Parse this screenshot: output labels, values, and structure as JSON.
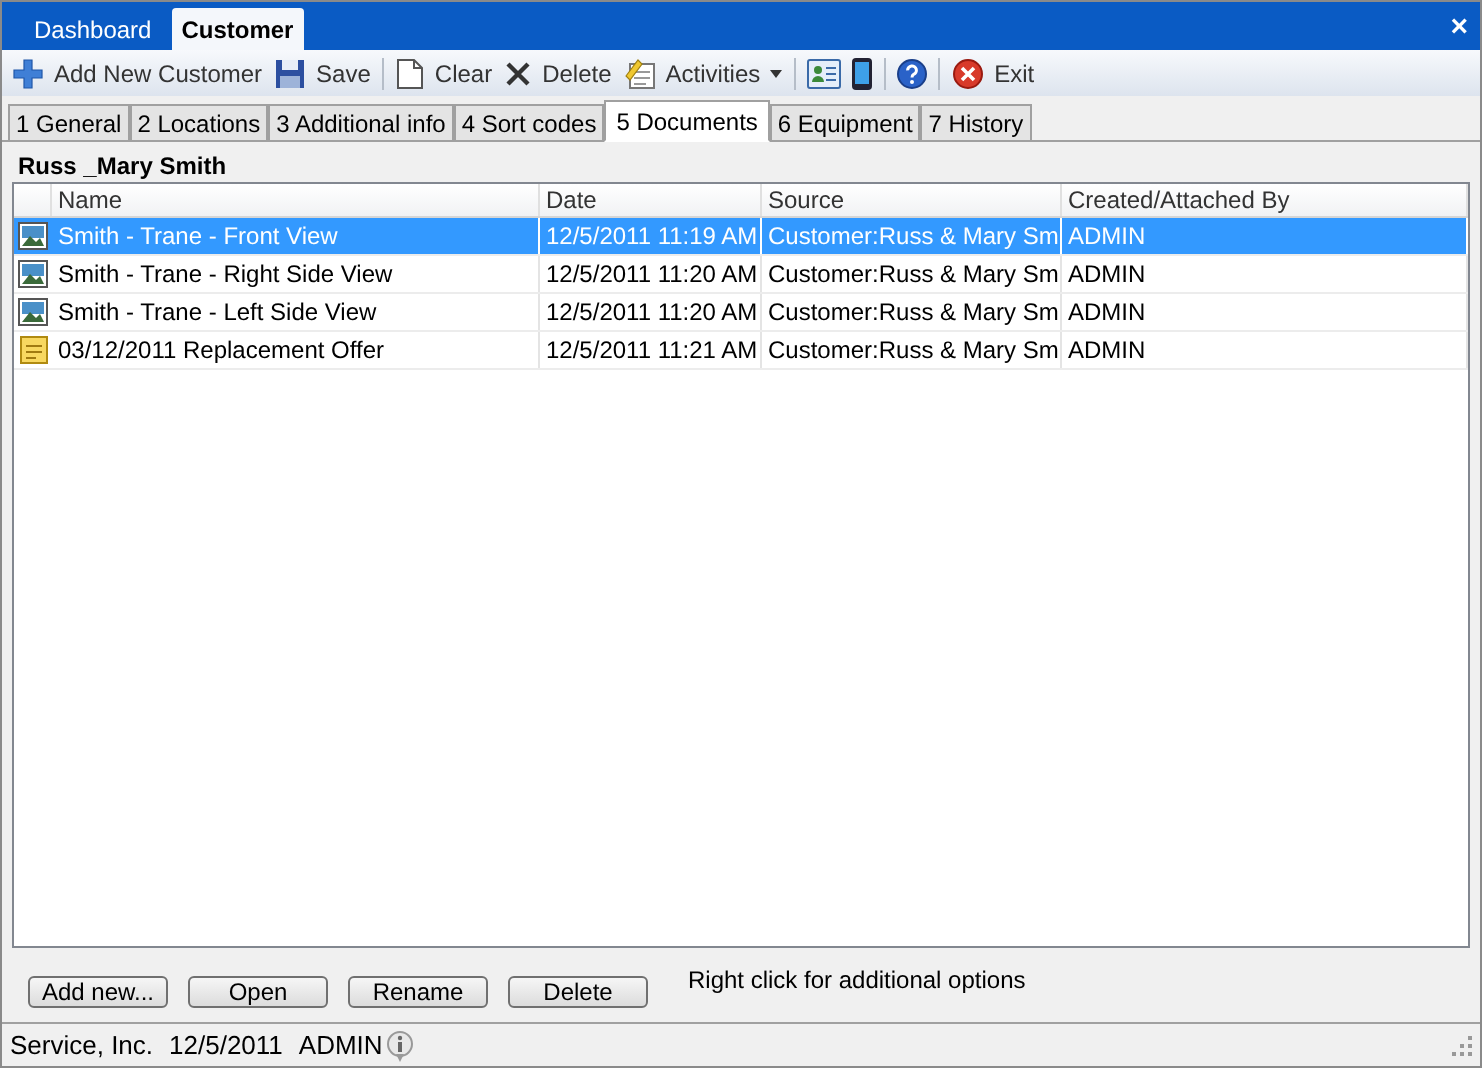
{
  "top_tabs": [
    {
      "label": "Dashboard",
      "selected": false
    },
    {
      "label": "Customer",
      "selected": true
    }
  ],
  "close_glyph": "×",
  "toolbar": [
    {
      "kind": "plus",
      "label": "Add New Customer"
    },
    {
      "kind": "save",
      "label": "Save"
    },
    {
      "kind": "separator"
    },
    {
      "kind": "page",
      "label": "Clear"
    },
    {
      "kind": "delete",
      "label": "Delete"
    },
    {
      "kind": "notepad",
      "label": "Activities",
      "dropdown": true
    },
    {
      "kind": "separator"
    },
    {
      "kind": "card"
    },
    {
      "kind": "phone"
    },
    {
      "kind": "separator"
    },
    {
      "kind": "help"
    },
    {
      "kind": "separator"
    },
    {
      "kind": "exit",
      "label": "Exit"
    }
  ],
  "tabs": [
    {
      "label": "1 General",
      "selected": false
    },
    {
      "label": "2 Locations",
      "selected": false
    },
    {
      "label": "3 Additional info",
      "selected": false
    },
    {
      "label": "4 Sort codes",
      "selected": false
    },
    {
      "label": "5 Documents",
      "selected": true
    },
    {
      "label": "6 Equipment",
      "selected": false
    },
    {
      "label": "7 History",
      "selected": false
    }
  ],
  "customer_name": "Russ _Mary Smith",
  "table": {
    "columns": [
      "Name",
      "Date",
      "Source",
      "Created/Attached By"
    ],
    "rows": [
      {
        "kind": "image",
        "selected": true,
        "cells": [
          "Smith - Trane - Front View",
          "12/5/2011 11:19 AM",
          "Customer:Russ & Mary Sm",
          "ADMIN"
        ]
      },
      {
        "kind": "image",
        "selected": false,
        "cells": [
          "Smith - Trane - Right Side View",
          "12/5/2011 11:20 AM",
          "Customer:Russ & Mary Sm",
          "ADMIN"
        ]
      },
      {
        "kind": "image",
        "selected": false,
        "cells": [
          "Smith - Trane - Left Side View",
          "12/5/2011 11:20 AM",
          "Customer:Russ & Mary Sm",
          "ADMIN"
        ]
      },
      {
        "kind": "note",
        "selected": false,
        "cells": [
          "03/12/2011 Replacement Offer",
          "12/5/2011 11:21 AM",
          "Customer:Russ & Mary Sm",
          "ADMIN"
        ]
      }
    ]
  },
  "buttons": [
    "Add new...",
    "Open",
    "Rename",
    "Delete"
  ],
  "hint": "Right click for additional options",
  "status_bar": {
    "company": "Service, Inc.",
    "date": "12/5/2011",
    "user": "ADMIN"
  }
}
